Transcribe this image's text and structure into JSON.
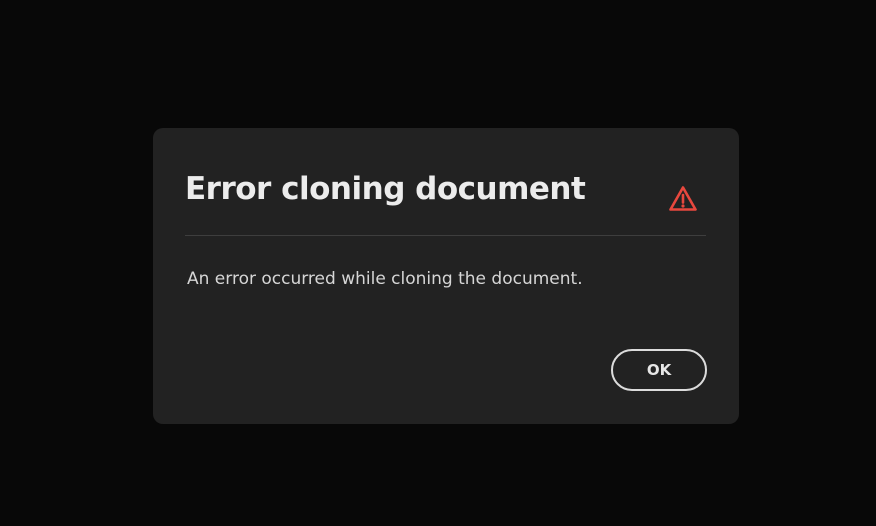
{
  "dialog": {
    "title": "Error cloning document",
    "icon": "alert-triangle-icon",
    "message": "An error occurred while cloning the document.",
    "ok_label": "OK"
  },
  "colors": {
    "backdrop": "#080808",
    "dialog_bg": "#222222",
    "alert": "#e8483e",
    "text": "#ececec"
  }
}
